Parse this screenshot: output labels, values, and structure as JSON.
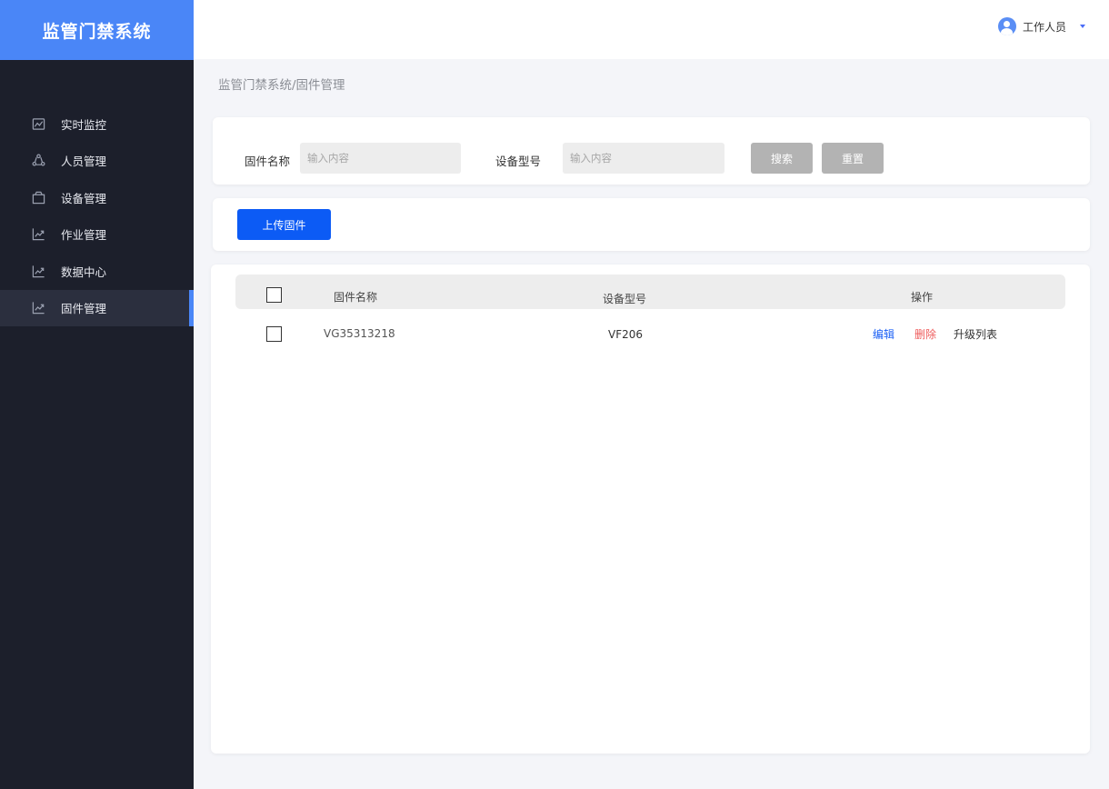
{
  "app": {
    "title": "监管门禁系统"
  },
  "sidebar": {
    "items": [
      {
        "label": "实时监控",
        "icon": "monitor-chart-icon"
      },
      {
        "label": "人员管理",
        "icon": "people-cycle-icon"
      },
      {
        "label": "设备管理",
        "icon": "box-icon"
      },
      {
        "label": "作业管理",
        "icon": "trend-chart-icon"
      },
      {
        "label": "数据中心",
        "icon": "trend-chart-icon"
      },
      {
        "label": "固件管理",
        "icon": "trend-chart-icon",
        "active": true
      }
    ]
  },
  "header": {
    "user_name": "工作人员",
    "avatar_icon": "user-avatar-icon",
    "accent": "#4a86f7"
  },
  "breadcrumb": "监管门禁系统/固件管理",
  "filter": {
    "firmware_label": "固件名称",
    "firmware_placeholder": "输入内容",
    "model_label": "设备型号",
    "model_placeholder": "输入内容",
    "search_label": "搜索",
    "reset_label": "重置"
  },
  "actions": {
    "upload_label": "上传固件"
  },
  "table": {
    "columns": [
      "固件名称",
      "设备型号",
      "操作"
    ],
    "rows": [
      {
        "firmware": "VG35313218",
        "model": "VF206",
        "edit": "编辑",
        "delete": "删除",
        "upgrade_list": "升级列表"
      }
    ]
  }
}
